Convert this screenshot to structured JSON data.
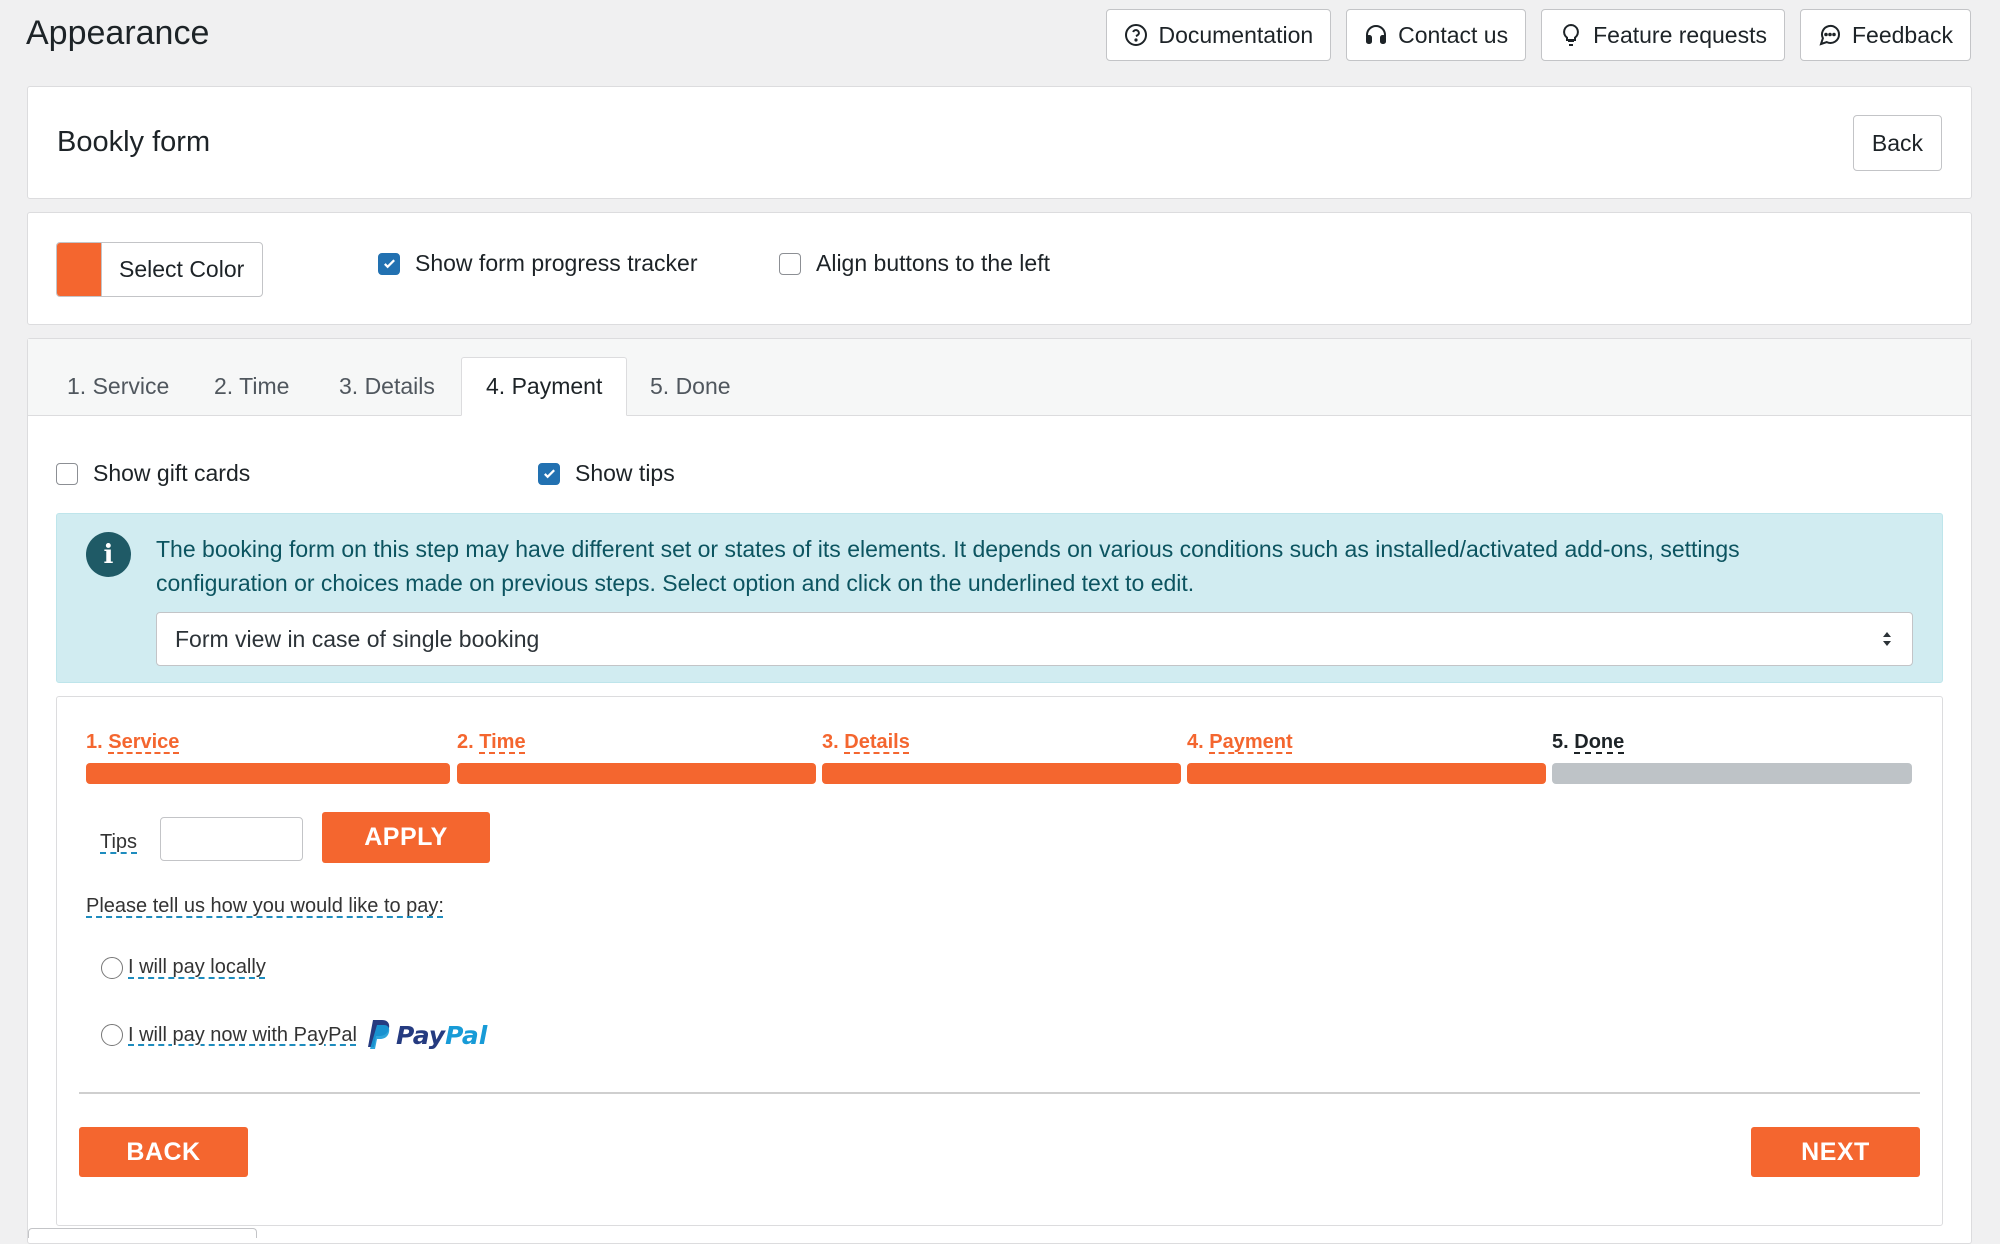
{
  "header": {
    "title": "Appearance",
    "buttons": {
      "documentation": "Documentation",
      "contact": "Contact us",
      "features": "Feature requests",
      "feedback": "Feedback"
    }
  },
  "form_card": {
    "title": "Bookly form",
    "back_label": "Back"
  },
  "options": {
    "color_label": "Select Color",
    "color": "#f4662f",
    "progress_tracker": {
      "label": "Show form progress tracker",
      "checked": true
    },
    "align_left": {
      "label": "Align buttons to the left",
      "checked": false
    }
  },
  "tabs": [
    {
      "label": "1. Service",
      "active": false
    },
    {
      "label": "2. Time",
      "active": false
    },
    {
      "label": "3. Details",
      "active": false
    },
    {
      "label": "4. Payment",
      "active": true
    },
    {
      "label": "5. Done",
      "active": false
    }
  ],
  "payment_options": {
    "gift_cards": {
      "label": "Show gift cards",
      "checked": false
    },
    "tips": {
      "label": "Show tips",
      "checked": true
    }
  },
  "info": {
    "text": "The booking form on this step may have different set or states of its elements. It depends on various conditions such as installed/activated add-ons, settings configuration or choices made on previous steps. Select option and click on the underlined text to edit.",
    "select_value": "Form view in case of single booking"
  },
  "preview": {
    "steps": [
      {
        "num": "1.",
        "name": "Service",
        "done": true
      },
      {
        "num": "2.",
        "name": "Time",
        "done": true
      },
      {
        "num": "3.",
        "name": "Details",
        "done": true
      },
      {
        "num": "4.",
        "name": "Payment",
        "done": true
      },
      {
        "num": "5.",
        "name": "Done",
        "done": false
      }
    ],
    "tips_label": "Tips",
    "tips_value": "",
    "apply_label": "APPLY",
    "pay_prompt": "Please tell us how you would like to pay:",
    "pay_local": "I will pay locally",
    "pay_paypal": "I will pay now with PayPal",
    "paypal_brand": "PayPal",
    "back_label": "BACK",
    "next_label": "NEXT",
    "colors": {
      "accent": "#f4662f",
      "inactive": "#bec3c7",
      "paypal_dark": "#253b80",
      "paypal_light": "#179bd7"
    }
  }
}
